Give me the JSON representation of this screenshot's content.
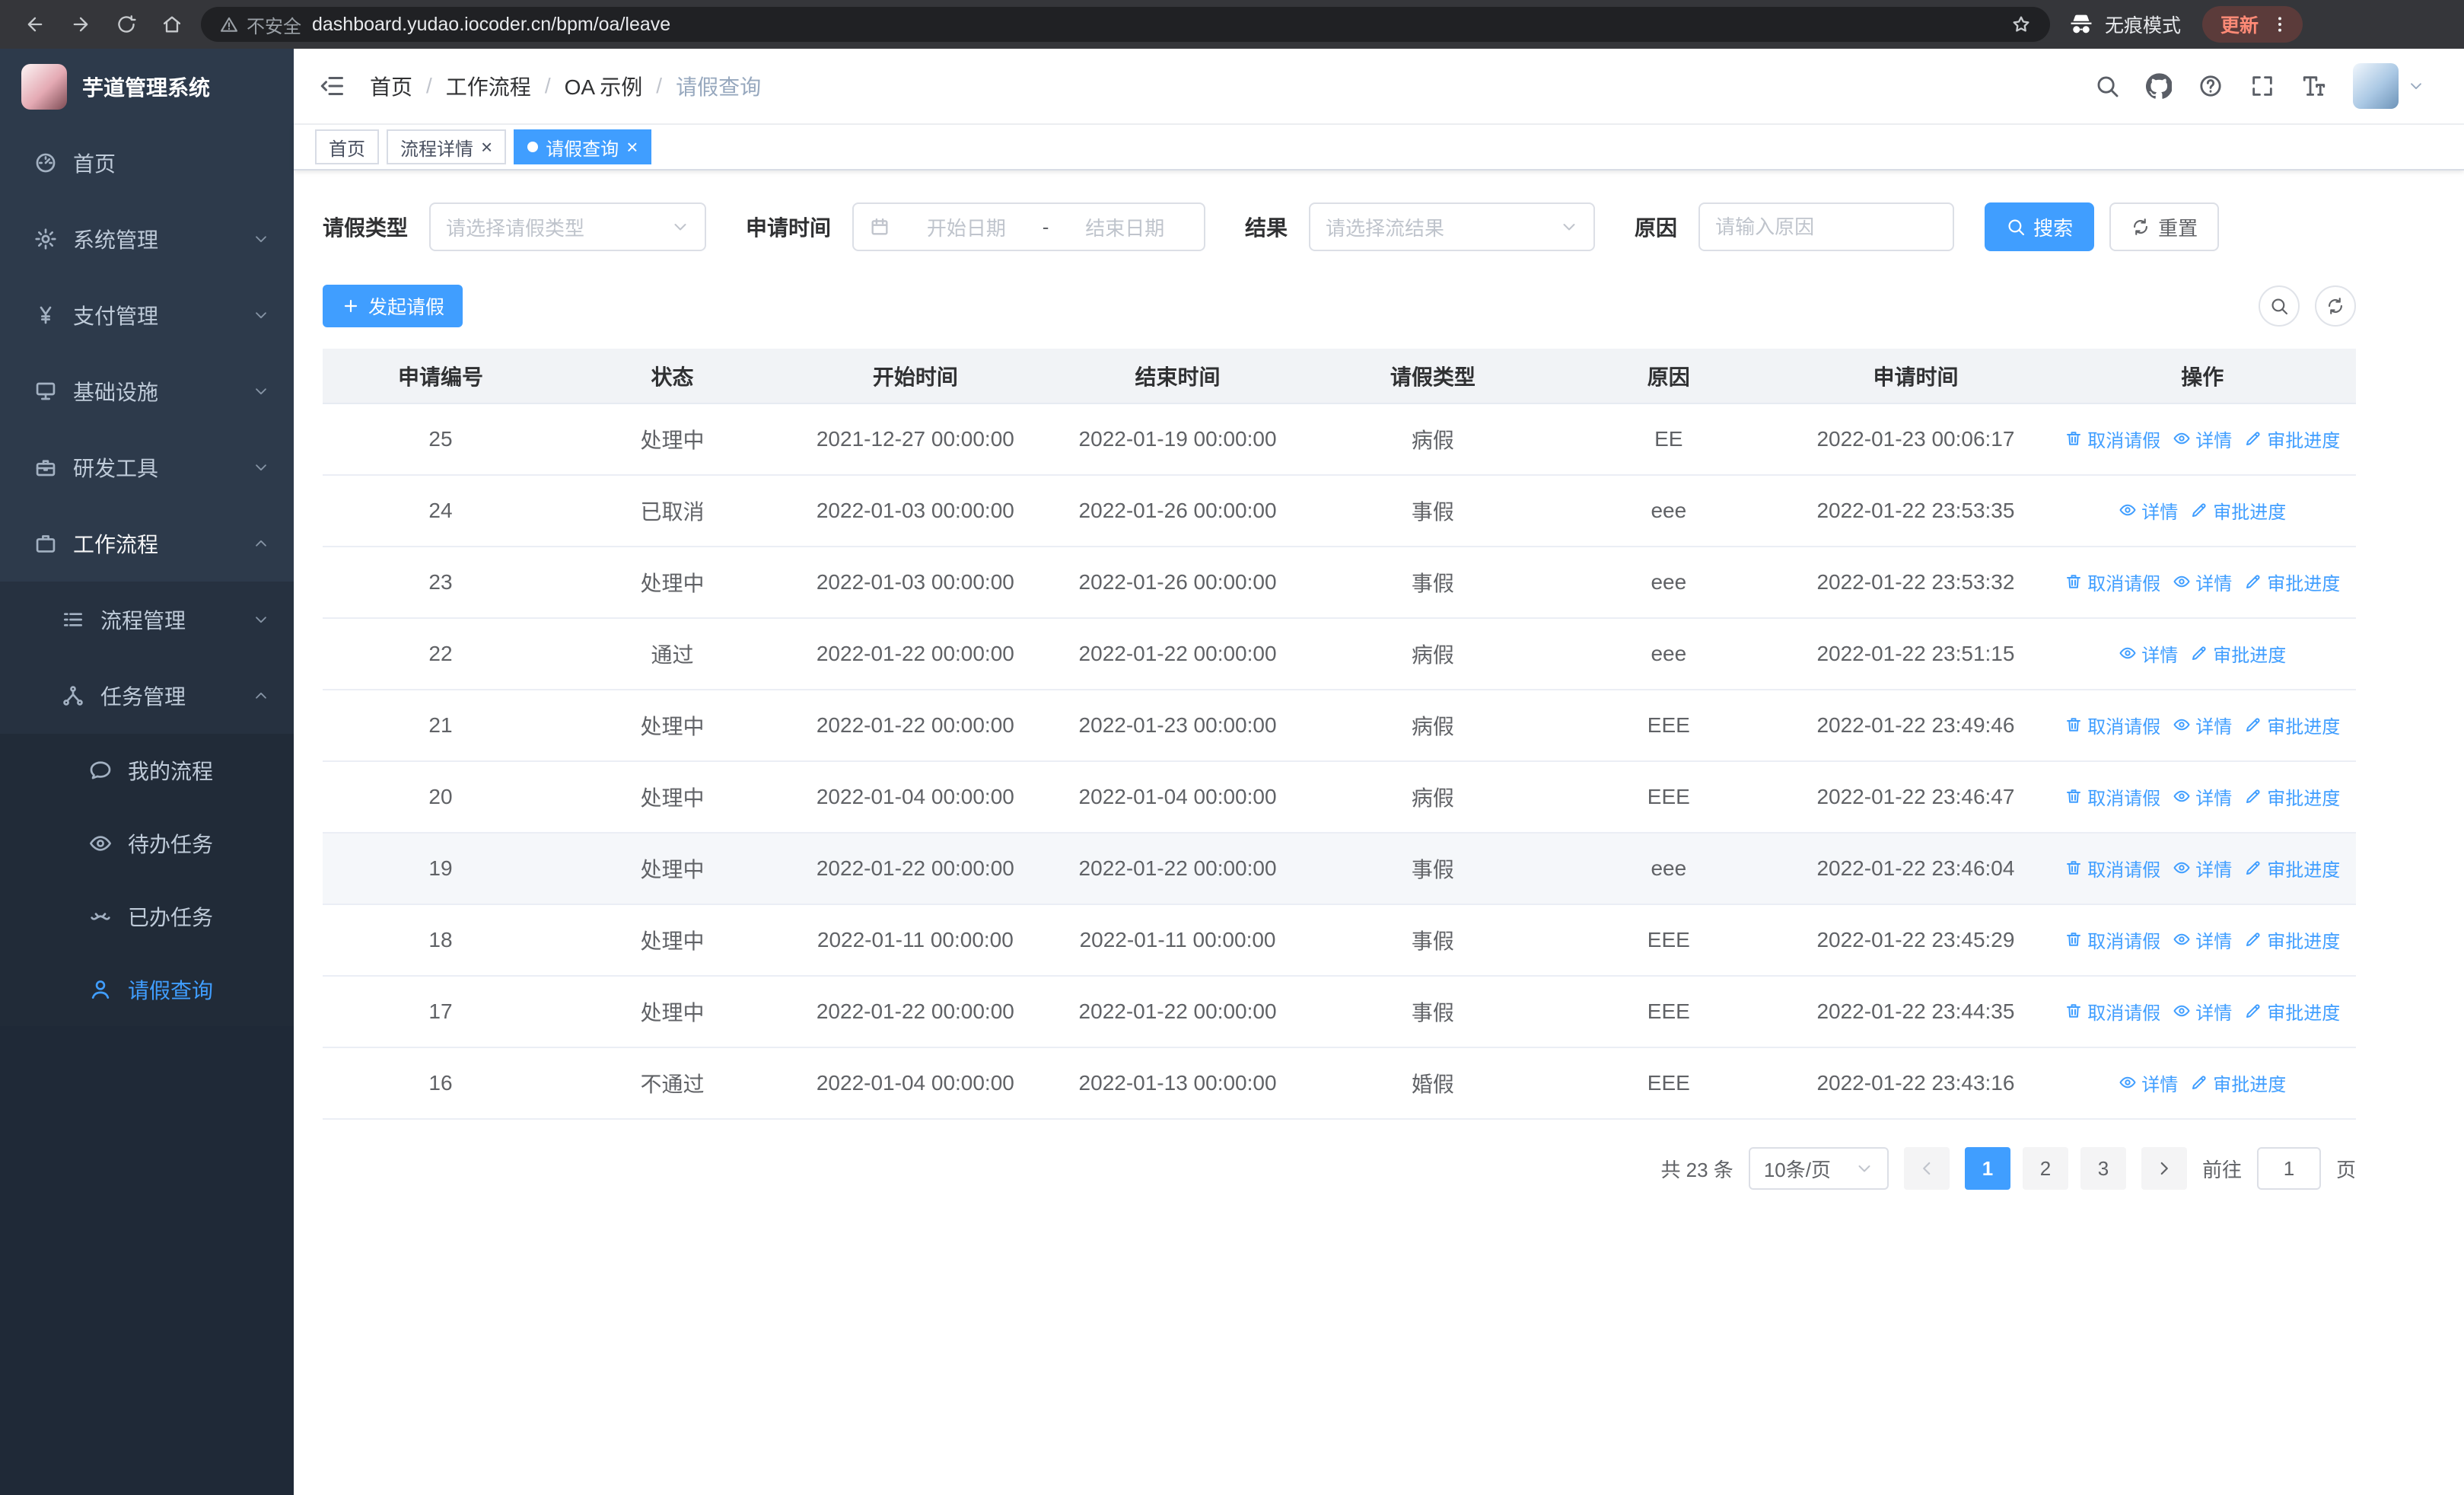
{
  "colors": {
    "accent": "#409eff"
  },
  "app_title": "芋道管理系统",
  "browser": {
    "security_label": "不安全",
    "url": "dashboard.yudao.iocoder.cn/bpm/oa/leave",
    "incognito_label": "无痕模式",
    "update_label": "更新"
  },
  "sidebar": {
    "menu": [
      {
        "label": "首页",
        "icon": "dashboard-icon",
        "level": 1
      },
      {
        "label": "系统管理",
        "icon": "gear-icon",
        "level": 1,
        "arrow": "down"
      },
      {
        "label": "支付管理",
        "icon": "yen-icon",
        "level": 1,
        "arrow": "down"
      },
      {
        "label": "基础设施",
        "icon": "server-icon",
        "level": 1,
        "arrow": "down"
      },
      {
        "label": "研发工具",
        "icon": "toolbox-icon",
        "level": 1,
        "arrow": "down"
      },
      {
        "label": "工作流程",
        "icon": "briefcase-icon",
        "level": 1,
        "arrow": "up",
        "expanded": true
      },
      {
        "label": "流程管理",
        "icon": "process-icon",
        "level": 2,
        "arrow": "down"
      },
      {
        "label": "任务管理",
        "icon": "flow-icon",
        "level": 2,
        "arrow": "up",
        "expanded": true
      },
      {
        "label": "我的流程",
        "icon": "chat-icon",
        "level": 3
      },
      {
        "label": "待办任务",
        "icon": "eye-icon",
        "level": 3
      },
      {
        "label": "已办任务",
        "icon": "done-icon",
        "level": 3
      },
      {
        "label": "请假查询",
        "icon": "person-icon",
        "level": 3,
        "active": true
      }
    ]
  },
  "header": {
    "breadcrumb": [
      "首页",
      "工作流程",
      "OA 示例",
      "请假查询"
    ]
  },
  "tabs": [
    {
      "label": "首页",
      "closable": false,
      "active": false
    },
    {
      "label": "流程详情",
      "closable": true,
      "active": false
    },
    {
      "label": "请假查询",
      "closable": true,
      "active": true
    }
  ],
  "filters": {
    "leave_type_label": "请假类型",
    "leave_type_placeholder": "请选择请假类型",
    "apply_time_label": "申请时间",
    "date_start_placeholder": "开始日期",
    "date_separator": "-",
    "date_end_placeholder": "结束日期",
    "result_label": "结果",
    "result_placeholder": "请选择流结果",
    "reason_label": "原因",
    "reason_placeholder": "请输入原因",
    "search_label": "搜索",
    "reset_label": "重置"
  },
  "toolbar": {
    "create_label": "发起请假"
  },
  "table": {
    "columns": [
      "申请编号",
      "状态",
      "开始时间",
      "结束时间",
      "请假类型",
      "原因",
      "申请时间",
      "操作"
    ],
    "action_labels": {
      "cancel": "取消请假",
      "detail": "详情",
      "progress": "审批进度"
    },
    "rows": [
      {
        "id": "25",
        "status": "处理中",
        "start": "2021-12-27 00:00:00",
        "end": "2022-01-19 00:00:00",
        "type": "病假",
        "reason": "EE",
        "apply_time": "2022-01-23 00:06:17",
        "actions": [
          "cancel",
          "detail",
          "progress"
        ]
      },
      {
        "id": "24",
        "status": "已取消",
        "start": "2022-01-03 00:00:00",
        "end": "2022-01-26 00:00:00",
        "type": "事假",
        "reason": "eee",
        "apply_time": "2022-01-22 23:53:35",
        "actions": [
          "detail",
          "progress"
        ]
      },
      {
        "id": "23",
        "status": "处理中",
        "start": "2022-01-03 00:00:00",
        "end": "2022-01-26 00:00:00",
        "type": "事假",
        "reason": "eee",
        "apply_time": "2022-01-22 23:53:32",
        "actions": [
          "cancel",
          "detail",
          "progress"
        ]
      },
      {
        "id": "22",
        "status": "通过",
        "start": "2022-01-22 00:00:00",
        "end": "2022-01-22 00:00:00",
        "type": "病假",
        "reason": "eee",
        "apply_time": "2022-01-22 23:51:15",
        "actions": [
          "detail",
          "progress"
        ]
      },
      {
        "id": "21",
        "status": "处理中",
        "start": "2022-01-22 00:00:00",
        "end": "2022-01-23 00:00:00",
        "type": "病假",
        "reason": "EEE",
        "apply_time": "2022-01-22 23:49:46",
        "actions": [
          "cancel",
          "detail",
          "progress"
        ]
      },
      {
        "id": "20",
        "status": "处理中",
        "start": "2022-01-04 00:00:00",
        "end": "2022-01-04 00:00:00",
        "type": "病假",
        "reason": "EEE",
        "apply_time": "2022-01-22 23:46:47",
        "actions": [
          "cancel",
          "detail",
          "progress"
        ]
      },
      {
        "id": "19",
        "status": "处理中",
        "start": "2022-01-22 00:00:00",
        "end": "2022-01-22 00:00:00",
        "type": "事假",
        "reason": "eee",
        "apply_time": "2022-01-22 23:46:04",
        "actions": [
          "cancel",
          "detail",
          "progress"
        ],
        "highlighted": true
      },
      {
        "id": "18",
        "status": "处理中",
        "start": "2022-01-11 00:00:00",
        "end": "2022-01-11 00:00:00",
        "type": "事假",
        "reason": "EEE",
        "apply_time": "2022-01-22 23:45:29",
        "actions": [
          "cancel",
          "detail",
          "progress"
        ]
      },
      {
        "id": "17",
        "status": "处理中",
        "start": "2022-01-22 00:00:00",
        "end": "2022-01-22 00:00:00",
        "type": "事假",
        "reason": "EEE",
        "apply_time": "2022-01-22 23:44:35",
        "actions": [
          "cancel",
          "detail",
          "progress"
        ]
      },
      {
        "id": "16",
        "status": "不通过",
        "start": "2022-01-04 00:00:00",
        "end": "2022-01-13 00:00:00",
        "type": "婚假",
        "reason": "EEE",
        "apply_time": "2022-01-22 23:43:16",
        "actions": [
          "detail",
          "progress"
        ]
      }
    ]
  },
  "pagination": {
    "total": "共 23 条",
    "page_size": "10条/页",
    "pages": [
      "1",
      "2",
      "3"
    ],
    "active_page": "1",
    "goto_label": "前往",
    "goto_value": "1",
    "unit_label": "页"
  }
}
